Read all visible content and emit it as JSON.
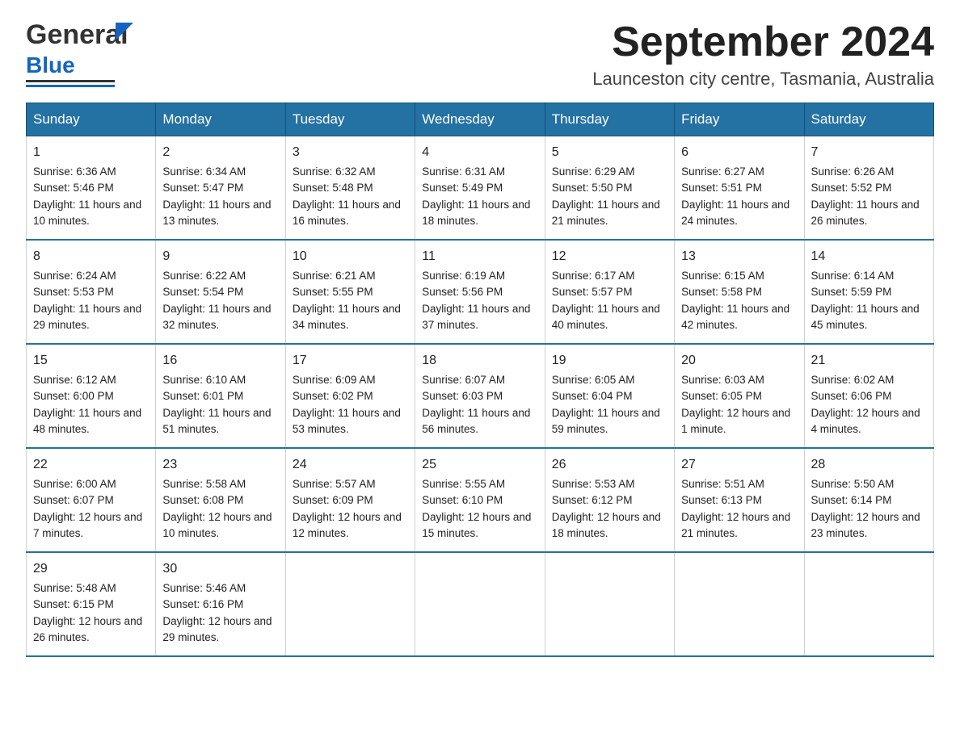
{
  "header": {
    "title": "September 2024",
    "subtitle": "Launceston city centre, Tasmania, Australia",
    "logo_general": "General",
    "logo_blue": "Blue"
  },
  "columns": [
    "Sunday",
    "Monday",
    "Tuesday",
    "Wednesday",
    "Thursday",
    "Friday",
    "Saturday"
  ],
  "weeks": [
    [
      {
        "day": "1",
        "sunrise": "Sunrise: 6:36 AM",
        "sunset": "Sunset: 5:46 PM",
        "daylight": "Daylight: 11 hours and 10 minutes."
      },
      {
        "day": "2",
        "sunrise": "Sunrise: 6:34 AM",
        "sunset": "Sunset: 5:47 PM",
        "daylight": "Daylight: 11 hours and 13 minutes."
      },
      {
        "day": "3",
        "sunrise": "Sunrise: 6:32 AM",
        "sunset": "Sunset: 5:48 PM",
        "daylight": "Daylight: 11 hours and 16 minutes."
      },
      {
        "day": "4",
        "sunrise": "Sunrise: 6:31 AM",
        "sunset": "Sunset: 5:49 PM",
        "daylight": "Daylight: 11 hours and 18 minutes."
      },
      {
        "day": "5",
        "sunrise": "Sunrise: 6:29 AM",
        "sunset": "Sunset: 5:50 PM",
        "daylight": "Daylight: 11 hours and 21 minutes."
      },
      {
        "day": "6",
        "sunrise": "Sunrise: 6:27 AM",
        "sunset": "Sunset: 5:51 PM",
        "daylight": "Daylight: 11 hours and 24 minutes."
      },
      {
        "day": "7",
        "sunrise": "Sunrise: 6:26 AM",
        "sunset": "Sunset: 5:52 PM",
        "daylight": "Daylight: 11 hours and 26 minutes."
      }
    ],
    [
      {
        "day": "8",
        "sunrise": "Sunrise: 6:24 AM",
        "sunset": "Sunset: 5:53 PM",
        "daylight": "Daylight: 11 hours and 29 minutes."
      },
      {
        "day": "9",
        "sunrise": "Sunrise: 6:22 AM",
        "sunset": "Sunset: 5:54 PM",
        "daylight": "Daylight: 11 hours and 32 minutes."
      },
      {
        "day": "10",
        "sunrise": "Sunrise: 6:21 AM",
        "sunset": "Sunset: 5:55 PM",
        "daylight": "Daylight: 11 hours and 34 minutes."
      },
      {
        "day": "11",
        "sunrise": "Sunrise: 6:19 AM",
        "sunset": "Sunset: 5:56 PM",
        "daylight": "Daylight: 11 hours and 37 minutes."
      },
      {
        "day": "12",
        "sunrise": "Sunrise: 6:17 AM",
        "sunset": "Sunset: 5:57 PM",
        "daylight": "Daylight: 11 hours and 40 minutes."
      },
      {
        "day": "13",
        "sunrise": "Sunrise: 6:15 AM",
        "sunset": "Sunset: 5:58 PM",
        "daylight": "Daylight: 11 hours and 42 minutes."
      },
      {
        "day": "14",
        "sunrise": "Sunrise: 6:14 AM",
        "sunset": "Sunset: 5:59 PM",
        "daylight": "Daylight: 11 hours and 45 minutes."
      }
    ],
    [
      {
        "day": "15",
        "sunrise": "Sunrise: 6:12 AM",
        "sunset": "Sunset: 6:00 PM",
        "daylight": "Daylight: 11 hours and 48 minutes."
      },
      {
        "day": "16",
        "sunrise": "Sunrise: 6:10 AM",
        "sunset": "Sunset: 6:01 PM",
        "daylight": "Daylight: 11 hours and 51 minutes."
      },
      {
        "day": "17",
        "sunrise": "Sunrise: 6:09 AM",
        "sunset": "Sunset: 6:02 PM",
        "daylight": "Daylight: 11 hours and 53 minutes."
      },
      {
        "day": "18",
        "sunrise": "Sunrise: 6:07 AM",
        "sunset": "Sunset: 6:03 PM",
        "daylight": "Daylight: 11 hours and 56 minutes."
      },
      {
        "day": "19",
        "sunrise": "Sunrise: 6:05 AM",
        "sunset": "Sunset: 6:04 PM",
        "daylight": "Daylight: 11 hours and 59 minutes."
      },
      {
        "day": "20",
        "sunrise": "Sunrise: 6:03 AM",
        "sunset": "Sunset: 6:05 PM",
        "daylight": "Daylight: 12 hours and 1 minute."
      },
      {
        "day": "21",
        "sunrise": "Sunrise: 6:02 AM",
        "sunset": "Sunset: 6:06 PM",
        "daylight": "Daylight: 12 hours and 4 minutes."
      }
    ],
    [
      {
        "day": "22",
        "sunrise": "Sunrise: 6:00 AM",
        "sunset": "Sunset: 6:07 PM",
        "daylight": "Daylight: 12 hours and 7 minutes."
      },
      {
        "day": "23",
        "sunrise": "Sunrise: 5:58 AM",
        "sunset": "Sunset: 6:08 PM",
        "daylight": "Daylight: 12 hours and 10 minutes."
      },
      {
        "day": "24",
        "sunrise": "Sunrise: 5:57 AM",
        "sunset": "Sunset: 6:09 PM",
        "daylight": "Daylight: 12 hours and 12 minutes."
      },
      {
        "day": "25",
        "sunrise": "Sunrise: 5:55 AM",
        "sunset": "Sunset: 6:10 PM",
        "daylight": "Daylight: 12 hours and 15 minutes."
      },
      {
        "day": "26",
        "sunrise": "Sunrise: 5:53 AM",
        "sunset": "Sunset: 6:12 PM",
        "daylight": "Daylight: 12 hours and 18 minutes."
      },
      {
        "day": "27",
        "sunrise": "Sunrise: 5:51 AM",
        "sunset": "Sunset: 6:13 PM",
        "daylight": "Daylight: 12 hours and 21 minutes."
      },
      {
        "day": "28",
        "sunrise": "Sunrise: 5:50 AM",
        "sunset": "Sunset: 6:14 PM",
        "daylight": "Daylight: 12 hours and 23 minutes."
      }
    ],
    [
      {
        "day": "29",
        "sunrise": "Sunrise: 5:48 AM",
        "sunset": "Sunset: 6:15 PM",
        "daylight": "Daylight: 12 hours and 26 minutes."
      },
      {
        "day": "30",
        "sunrise": "Sunrise: 5:46 AM",
        "sunset": "Sunset: 6:16 PM",
        "daylight": "Daylight: 12 hours and 29 minutes."
      },
      null,
      null,
      null,
      null,
      null
    ]
  ]
}
